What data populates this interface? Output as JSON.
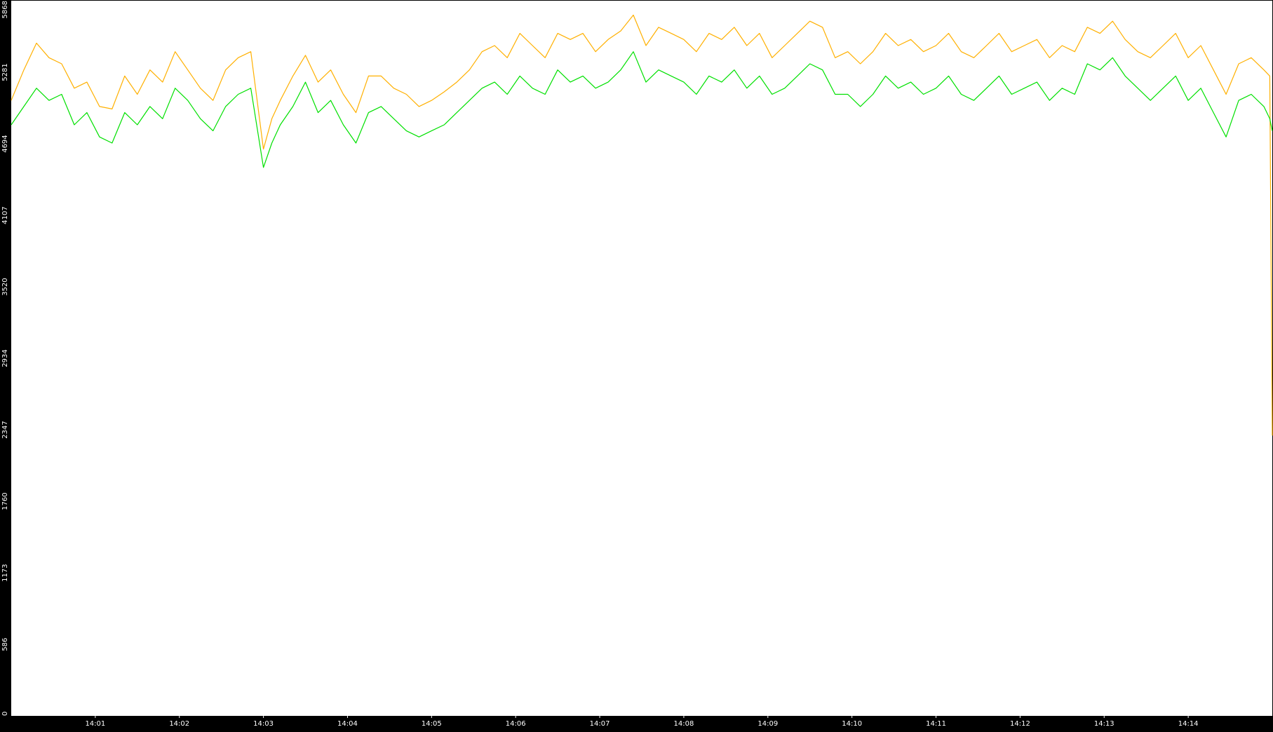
{
  "chart_data": {
    "type": "line",
    "title": "",
    "xlabel": "",
    "ylabel": "",
    "ylim": [
      0,
      5868
    ],
    "yticks": [
      0,
      586,
      1173,
      1760,
      2347,
      2934,
      3520,
      4107,
      4694,
      5281,
      5868
    ],
    "yticklabels": [
      "0",
      "586",
      "1173",
      "1760",
      "2347",
      "2934",
      "3520",
      "4107",
      "4694",
      "5281",
      "5868"
    ],
    "xrange_minutes": [
      0.0,
      15.0
    ],
    "xticks_minutes": [
      1,
      2,
      3,
      4,
      5,
      6,
      7,
      8,
      9,
      10,
      11,
      12,
      13,
      14
    ],
    "xticklabels": [
      "14:01",
      "14:02",
      "14:03",
      "14:04",
      "14:05",
      "14:06",
      "14:07",
      "14:08",
      "14:09",
      "14:10",
      "14:11",
      "14:12",
      "14:13",
      "14:14"
    ],
    "grid": false,
    "legend": "none",
    "colors": {
      "background": "#000000",
      "plot_area": "#ffffff",
      "series_upper": "#ffb000",
      "series_lower": "#00e000"
    },
    "series": [
      {
        "key": "upper",
        "color": "#ffb000",
        "x": [
          0.0,
          0.15,
          0.3,
          0.45,
          0.6,
          0.75,
          0.9,
          1.05,
          1.2,
          1.35,
          1.5,
          1.65,
          1.8,
          1.95,
          2.1,
          2.25,
          2.4,
          2.55,
          2.7,
          2.85,
          3.0,
          3.1,
          3.2,
          3.35,
          3.5,
          3.65,
          3.8,
          3.95,
          4.1,
          4.25,
          4.4,
          4.55,
          4.7,
          4.85,
          5.0,
          5.15,
          5.3,
          5.45,
          5.6,
          5.75,
          5.9,
          6.05,
          6.2,
          6.35,
          6.5,
          6.65,
          6.8,
          6.95,
          7.1,
          7.25,
          7.4,
          7.55,
          7.7,
          7.85,
          8.0,
          8.15,
          8.3,
          8.45,
          8.6,
          8.75,
          8.9,
          9.05,
          9.2,
          9.35,
          9.5,
          9.65,
          9.8,
          9.95,
          10.1,
          10.25,
          10.4,
          10.55,
          10.7,
          10.85,
          11.0,
          11.15,
          11.3,
          11.45,
          11.6,
          11.75,
          11.9,
          12.05,
          12.2,
          12.35,
          12.5,
          12.65,
          12.8,
          12.95,
          13.1,
          13.25,
          13.4,
          13.55,
          13.7,
          13.85,
          14.0,
          14.15,
          14.3,
          14.45,
          14.6,
          14.75,
          14.9,
          14.97,
          15.0
        ],
        "y": [
          5050,
          5300,
          5520,
          5400,
          5350,
          5150,
          5200,
          5000,
          4980,
          5250,
          5100,
          5300,
          5200,
          5450,
          5300,
          5150,
          5050,
          5300,
          5400,
          5450,
          4650,
          4900,
          5050,
          5250,
          5420,
          5200,
          5300,
          5100,
          4950,
          5250,
          5250,
          5150,
          5100,
          5000,
          5050,
          5120,
          5200,
          5300,
          5450,
          5500,
          5400,
          5600,
          5500,
          5400,
          5600,
          5550,
          5600,
          5450,
          5550,
          5620,
          5750,
          5500,
          5650,
          5600,
          5550,
          5450,
          5600,
          5550,
          5650,
          5500,
          5600,
          5400,
          5500,
          5600,
          5700,
          5650,
          5400,
          5450,
          5350,
          5450,
          5600,
          5500,
          5550,
          5450,
          5500,
          5600,
          5450,
          5400,
          5500,
          5600,
          5450,
          5500,
          5550,
          5400,
          5500,
          5450,
          5650,
          5600,
          5700,
          5550,
          5450,
          5400,
          5500,
          5600,
          5400,
          5500,
          5300,
          5100,
          5350,
          5400,
          5300,
          5250,
          2300
        ]
      },
      {
        "key": "lower",
        "color": "#00e000",
        "x": [
          0.0,
          0.15,
          0.3,
          0.45,
          0.6,
          0.75,
          0.9,
          1.05,
          1.2,
          1.35,
          1.5,
          1.65,
          1.8,
          1.95,
          2.1,
          2.25,
          2.4,
          2.55,
          2.7,
          2.85,
          3.0,
          3.1,
          3.2,
          3.35,
          3.5,
          3.65,
          3.8,
          3.95,
          4.1,
          4.25,
          4.4,
          4.55,
          4.7,
          4.85,
          5.0,
          5.15,
          5.3,
          5.45,
          5.6,
          5.75,
          5.9,
          6.05,
          6.2,
          6.35,
          6.5,
          6.65,
          6.8,
          6.95,
          7.1,
          7.25,
          7.4,
          7.55,
          7.7,
          7.85,
          8.0,
          8.15,
          8.3,
          8.45,
          8.6,
          8.75,
          8.9,
          9.05,
          9.2,
          9.35,
          9.5,
          9.65,
          9.8,
          9.95,
          10.1,
          10.25,
          10.4,
          10.55,
          10.7,
          10.85,
          11.0,
          11.15,
          11.3,
          11.45,
          11.6,
          11.75,
          11.9,
          12.05,
          12.2,
          12.35,
          12.5,
          12.65,
          12.8,
          12.95,
          13.1,
          13.25,
          13.4,
          13.55,
          13.7,
          13.85,
          14.0,
          14.15,
          14.3,
          14.45,
          14.6,
          14.75,
          14.9,
          14.97,
          15.0
        ],
        "y": [
          4850,
          5000,
          5150,
          5050,
          5100,
          4850,
          4950,
          4750,
          4700,
          4950,
          4850,
          5000,
          4900,
          5150,
          5050,
          4900,
          4800,
          5000,
          5100,
          5150,
          4500,
          4700,
          4850,
          5000,
          5200,
          4950,
          5050,
          4850,
          4700,
          4950,
          5000,
          4900,
          4800,
          4750,
          4800,
          4850,
          4950,
          5050,
          5150,
          5200,
          5100,
          5250,
          5150,
          5100,
          5300,
          5200,
          5250,
          5150,
          5200,
          5300,
          5450,
          5200,
          5300,
          5250,
          5200,
          5100,
          5250,
          5200,
          5300,
          5150,
          5250,
          5100,
          5150,
          5250,
          5350,
          5300,
          5100,
          5100,
          5000,
          5100,
          5250,
          5150,
          5200,
          5100,
          5150,
          5250,
          5100,
          5050,
          5150,
          5250,
          5100,
          5150,
          5200,
          5050,
          5150,
          5100,
          5350,
          5300,
          5400,
          5250,
          5150,
          5050,
          5150,
          5250,
          5050,
          5150,
          4950,
          4750,
          5050,
          5100,
          5000,
          4900,
          4800
        ]
      }
    ]
  }
}
